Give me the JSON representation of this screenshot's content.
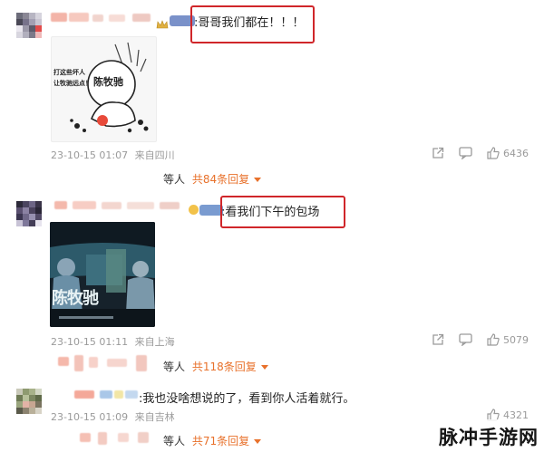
{
  "comments": [
    {
      "text": "哥哥我们都在！！！",
      "date": "23-10-15 01:07",
      "location": "来自四川",
      "like_count": "6436",
      "reply_who": "等人",
      "reply_link": "共84条回复"
    },
    {
      "text": "看我们下午的包场",
      "image_text": "陈牧驰",
      "date": "23-10-15 01:11",
      "location": "来自上海",
      "like_count": "5079",
      "reply_who": "等人",
      "reply_link": "共118条回复"
    },
    {
      "text": "我也没啥想说的了，看到你人活着就行。",
      "date": "23-10-15 01:09",
      "location": "来自吉林",
      "like_count": "4321",
      "reply_who": "等人",
      "reply_link": "共71条回复"
    }
  ],
  "sticker": {
    "name_text": "陈牧驰",
    "side_text_1": "打这些坏人",
    "side_text_2": "让牧驰远点！"
  },
  "watermark": "脉冲手游网",
  "colors": {
    "highlight": "#d0262a",
    "reply_link": "#e8712b",
    "meta": "#9a9a9a"
  }
}
